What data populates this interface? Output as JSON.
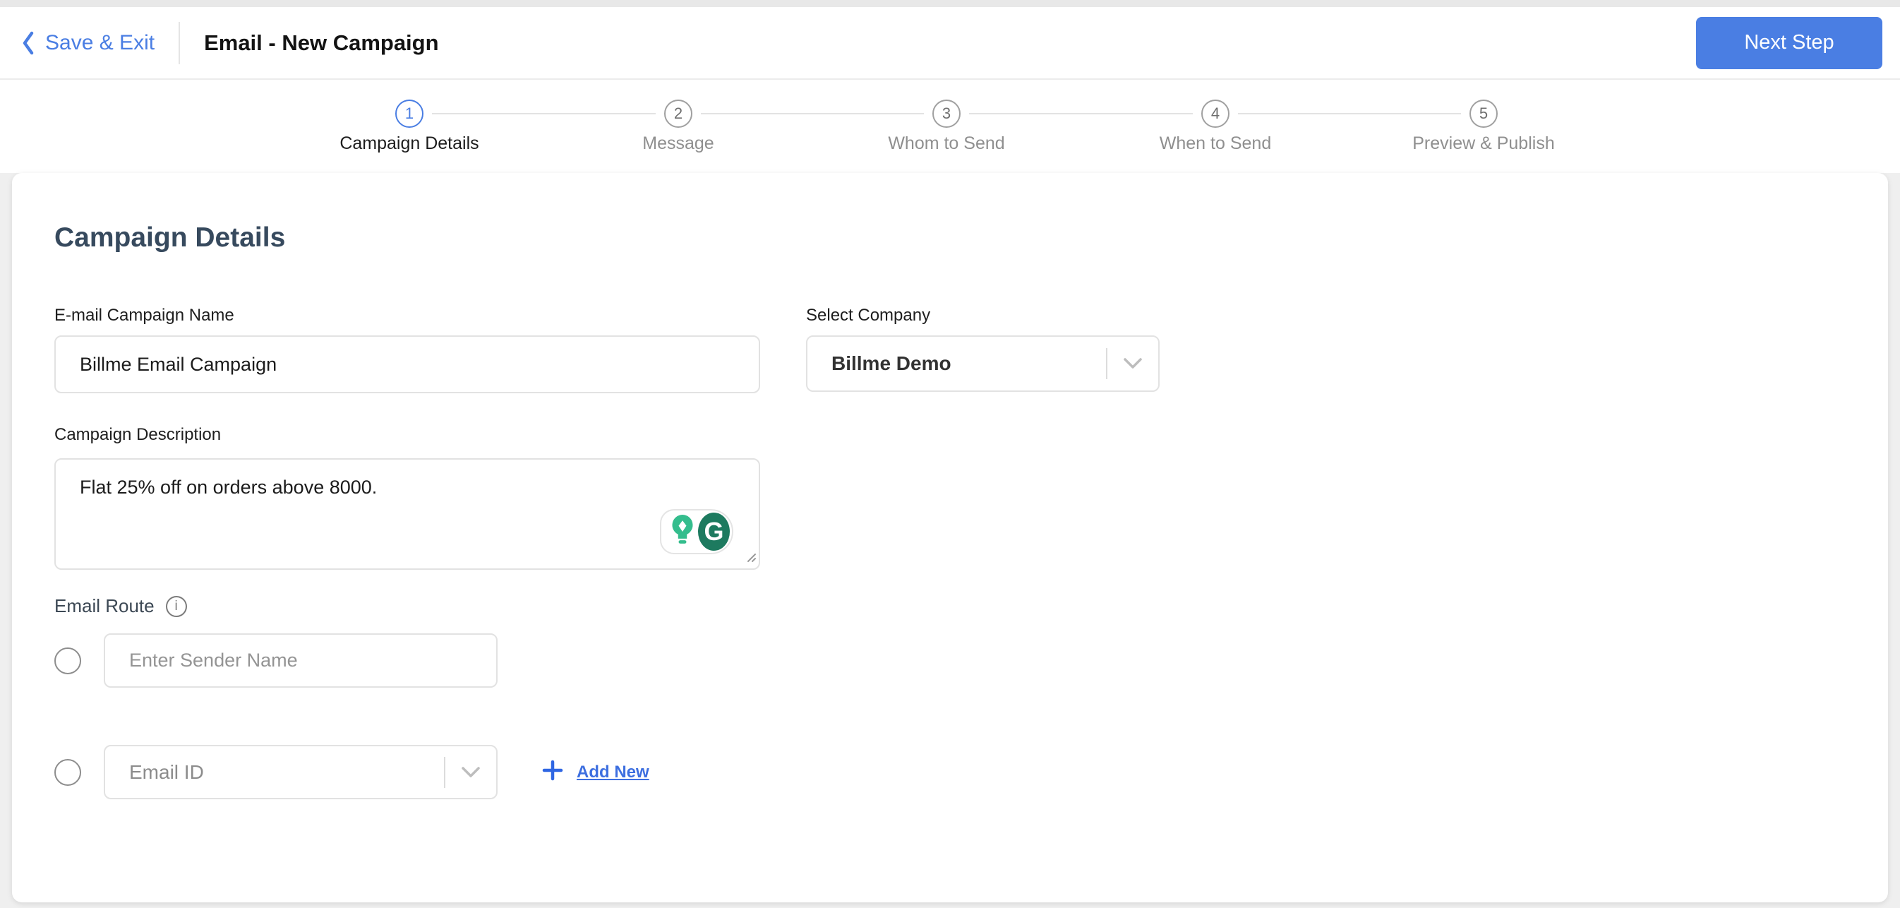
{
  "header": {
    "save_exit_label": "Save & Exit",
    "title": "Email - New Campaign",
    "next_step_label": "Next Step"
  },
  "stepper": {
    "steps": [
      {
        "number": "1",
        "label": "Campaign Details",
        "state": "active"
      },
      {
        "number": "2",
        "label": "Message",
        "state": "upcoming"
      },
      {
        "number": "3",
        "label": "Whom to Send",
        "state": "upcoming"
      },
      {
        "number": "4",
        "label": "When to Send",
        "state": "upcoming"
      },
      {
        "number": "5",
        "label": "Preview & Publish",
        "state": "upcoming"
      }
    ]
  },
  "form": {
    "heading": "Campaign Details",
    "campaign_name": {
      "label": "E-mail Campaign Name",
      "value": "Billme Email Campaign"
    },
    "company": {
      "label": "Select Company",
      "value": "Billme Demo"
    },
    "description": {
      "label": "Campaign Description",
      "value": "Flat 25% off on orders above 8000."
    },
    "email_route": {
      "label": "Email Route",
      "sender_name_placeholder": "Enter Sender Name",
      "email_id_placeholder": "Email ID",
      "add_new_label": "Add New"
    },
    "grammarly": {
      "g_letter": "G"
    }
  },
  "icons": {
    "back": "chevron-left-icon",
    "info": "info-icon",
    "dropdown": "chevron-down-icon",
    "add": "plus-icon",
    "suggestion": "lightbulb-icon",
    "grammarly": "grammarly-g-icon",
    "resize": "resize-handle-icon"
  },
  "colors": {
    "accent_blue": "#4a7ee3",
    "heading": "#374a5e",
    "grammarly_dark_green": "#1d7a5f",
    "grammarly_teal": "#34bd8d",
    "inactive_gray": "#8f8f8f",
    "border_gray": "#e2e2e2"
  }
}
